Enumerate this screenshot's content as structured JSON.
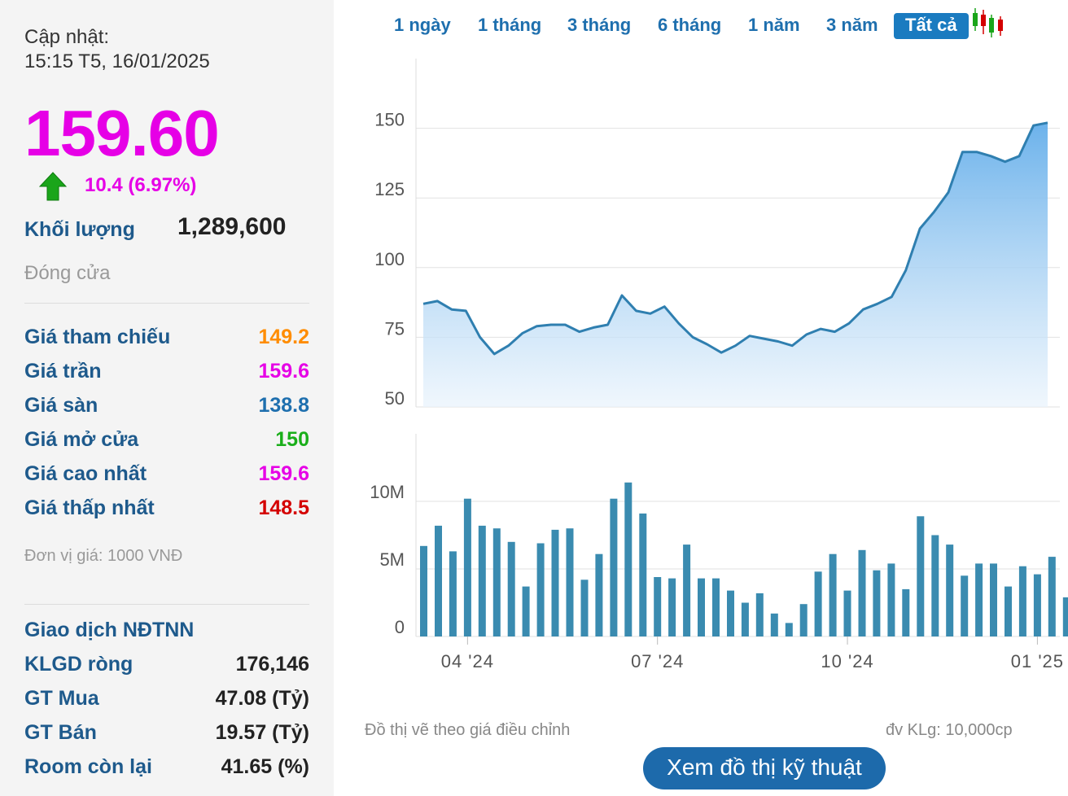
{
  "sidebar": {
    "update_label": "Cập nhật:",
    "update_time": "15:15 T5, 16/01/2025",
    "price": "159.60",
    "change": "10.4 (6.97%)",
    "volume_label": "Khối lượng",
    "volume_value": "1,289,600",
    "status": "Đóng cửa",
    "stats": [
      {
        "label": "Giá tham chiếu",
        "value": "149.2",
        "color": "#ff8c00"
      },
      {
        "label": "Giá trần",
        "value": "159.6",
        "color": "#e600e6"
      },
      {
        "label": "Giá sàn",
        "value": "138.8",
        "color": "#1e6fae"
      },
      {
        "label": "Giá mở cửa",
        "value": "150",
        "color": "#1aae1a"
      },
      {
        "label": "Giá cao nhất",
        "value": "159.6",
        "color": "#e600e6"
      },
      {
        "label": "Giá thấp nhất",
        "value": "148.5",
        "color": "#d40000"
      }
    ],
    "unit_note": "Đơn vị giá: 1000 VNĐ",
    "foreign": {
      "title": "Giao dịch NĐTNN",
      "rows": [
        {
          "label": "KLGD ròng",
          "value": "176,146"
        },
        {
          "label": "GT Mua",
          "value": "47.08 (Tỷ)"
        },
        {
          "label": "GT Bán",
          "value": "19.57 (Tỷ)"
        },
        {
          "label": "Room còn lại",
          "value": "41.65 (%)"
        }
      ]
    }
  },
  "tabs": [
    {
      "label": "1 ngày"
    },
    {
      "label": "1 tháng"
    },
    {
      "label": "3 tháng"
    },
    {
      "label": "6 tháng"
    },
    {
      "label": "1 năm"
    },
    {
      "label": "3 năm"
    },
    {
      "label": "Tất cả",
      "active": true
    }
  ],
  "colors": {
    "accent": "#1a7bc0",
    "line": "#2f7fb0",
    "bar": "#3a8bb0",
    "up": "#e600e6"
  },
  "chart_data": [
    {
      "type": "area",
      "ylim": [
        50,
        175
      ],
      "yticks": [
        50,
        75,
        100,
        125,
        150
      ],
      "values": [
        87,
        88,
        85,
        84.5,
        75,
        69,
        72,
        76.5,
        79,
        79.5,
        79.5,
        77,
        78.5,
        79.5,
        90,
        84.5,
        83.5,
        86,
        80,
        75,
        72.5,
        69.5,
        72,
        75.5,
        74.5,
        73.5,
        72,
        76,
        78,
        77,
        80,
        85,
        87,
        89.5,
        99,
        114,
        120,
        127,
        141.5,
        141.5,
        140,
        138,
        140,
        151,
        152
      ]
    },
    {
      "type": "bar",
      "ylim": [
        0,
        15
      ],
      "yticks": [
        0,
        5,
        10
      ],
      "ytick_labels": [
        "0",
        "5M",
        "10M"
      ],
      "values": [
        6.7,
        8.2,
        6.3,
        10.2,
        8.2,
        8,
        7,
        3.7,
        6.9,
        7.9,
        8,
        4.2,
        6.1,
        10.2,
        11.4,
        9.1,
        4.4,
        4.3,
        6.8,
        4.3,
        4.3,
        3.4,
        2.5,
        3.2,
        1.7,
        1,
        2.4,
        4.8,
        6.1,
        3.4,
        6.4,
        4.9,
        5.4,
        3.5,
        8.9,
        7.5,
        6.8,
        4.5,
        5.4,
        5.4,
        3.7,
        5.2,
        4.6,
        5.9,
        2.9
      ],
      "x_tick_labels": [
        "04 '24",
        "07 '24",
        "10 '24",
        "01 '25"
      ],
      "x_tick_bar_index": [
        3,
        16,
        29,
        42
      ]
    }
  ],
  "notes": {
    "left": "Đồ thị vẽ theo giá điều chỉnh",
    "right": "đv KLg: 10,000cp"
  },
  "button_label": "Xem đồ thị kỹ thuật"
}
